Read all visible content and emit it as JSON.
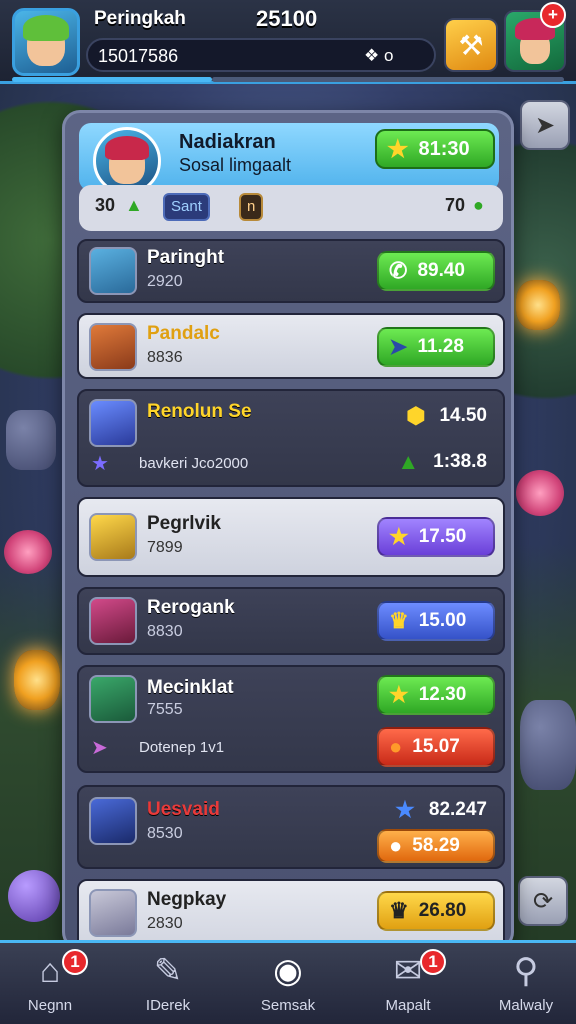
{
  "header": {
    "player_name": "Peringkah",
    "score": "25100",
    "player_id": "15017586",
    "diamond_value": "❖ o",
    "notification_count": "+"
  },
  "panel_head": {
    "title": "Nadiakran",
    "subtitle": "Sosal limgaalt",
    "button_value": "81:30"
  },
  "stats": {
    "left_value": "30",
    "tag1": "Sant",
    "tag2": "n",
    "right_value": "70"
  },
  "rows": [
    {
      "name": "Paringht",
      "sub": "2920",
      "value": "89.40",
      "button_icon": "phone-icon"
    },
    {
      "name": "Pandalc",
      "sub": "8836",
      "value": "11.28",
      "button_icon": "arrow-icon"
    },
    {
      "name": "Renolun Se",
      "sub": "",
      "value": "14.50",
      "value2": "1:38.8",
      "extra": "bavkeri Jco2000"
    },
    {
      "name": "Pegrlvik",
      "sub": "7899",
      "value": "17.50"
    },
    {
      "name": "Rerogank",
      "sub": "8830",
      "value": "15.00"
    },
    {
      "name": "Mecinklat",
      "sub": "7555",
      "value": "12.30",
      "value2": "15.07",
      "extra": "Dotenep 1v1"
    },
    {
      "name": "Uesvaid",
      "sub": "8530",
      "value": "82.247",
      "value2": "58.29"
    },
    {
      "name": "Negpkay",
      "sub": "2830",
      "value": "26.80"
    }
  ],
  "nav": {
    "items": [
      {
        "label": "Negnn",
        "badge": "1"
      },
      {
        "label": "IDerek"
      },
      {
        "label": "Semsak"
      },
      {
        "label": "Mapalt",
        "badge": "1"
      },
      {
        "label": "Malwaly"
      }
    ]
  },
  "colors": {
    "accent": "#4ab8f5",
    "green": "#2fa825",
    "purple": "#6a3fd8",
    "blue": "#3552c8",
    "red": "#c82a18",
    "gold": "#e0a012"
  }
}
